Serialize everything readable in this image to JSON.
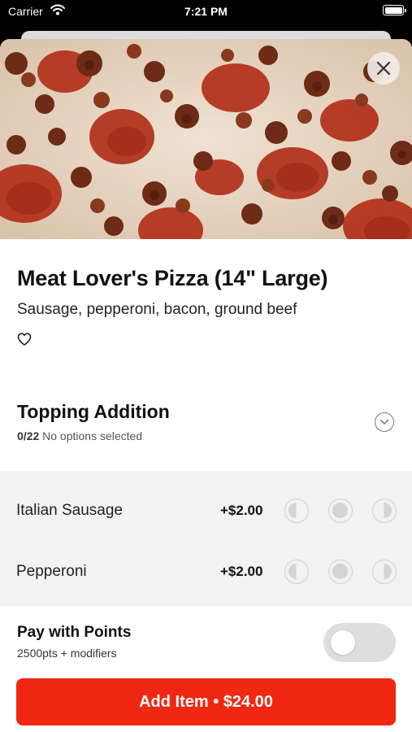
{
  "status_bar": {
    "carrier": "Carrier",
    "time": "7:21 PM",
    "wifi_icon": "wifi-icon",
    "battery_icon": "battery-icon"
  },
  "hero": {
    "image": "meat-lovers-pizza-photo",
    "close_icon": "close-icon"
  },
  "item": {
    "title": "Meat Lover's Pizza (14\" Large)",
    "description": "Sausage, pepperoni, bacon, ground beef",
    "favorite_icon": "heart-outline-icon"
  },
  "topping_section": {
    "title": "Topping Addition",
    "count": "0/22",
    "status": "No options selected",
    "chevron_icon": "chevron-down-circle-icon"
  },
  "toppings": [
    {
      "label": "Italian Sausage",
      "price": "+$2.00"
    },
    {
      "label": "Pepperoni",
      "price": "+$2.00"
    }
  ],
  "portion_icons": [
    "left-half-icon",
    "whole-icon",
    "right-half-icon"
  ],
  "points": {
    "title": "Pay with Points",
    "subtitle": "2500pts + modifiers",
    "enabled": false
  },
  "add_button": {
    "label": "Add Item • $24.00"
  },
  "colors": {
    "accent": "#f02712",
    "options_background": "#f2f2f2",
    "toggle_off": "#dedede"
  }
}
